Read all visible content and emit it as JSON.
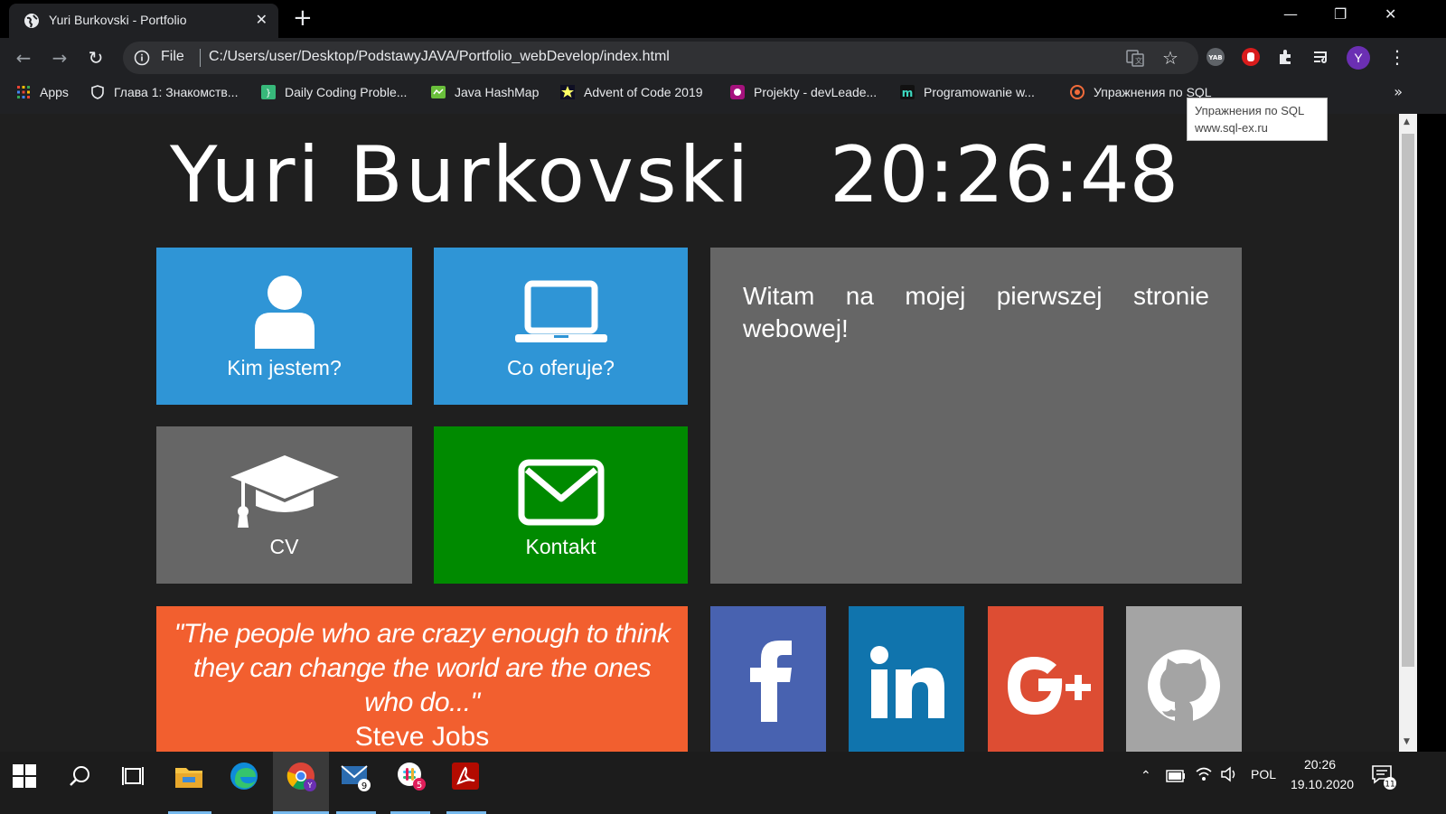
{
  "browser": {
    "tab_title": "Yuri Burkovski - Portfolio",
    "new_tab": "+",
    "address_scheme": "File",
    "address_url": "C:/Users/user/Desktop/PodstawyJAVA/Portfolio_webDevelop/index.html",
    "profile_letter": "Y",
    "ext_yab": "YAB"
  },
  "bookmarks": {
    "items": [
      {
        "label": "Apps"
      },
      {
        "label": "Глава 1: Знакомств..."
      },
      {
        "label": "Daily Coding Proble..."
      },
      {
        "label": "Java HashMap"
      },
      {
        "label": "Advent of Code 2019"
      },
      {
        "label": "Projekty - devLeade..."
      },
      {
        "label": "Programowanie w..."
      },
      {
        "label": "Упражнения по SQL"
      }
    ],
    "more": "»",
    "tooltip_title": "Упражнения по SQL",
    "tooltip_url": "www.sql-ex.ru"
  },
  "page": {
    "name": "Yuri Burkovski",
    "clock": "20:26:48",
    "tiles": {
      "about": "Kim jestem?",
      "offer": "Co oferuje?",
      "cv": "CV",
      "contact": "Kontakt"
    },
    "welcome": "Witam na mojej pierwszej stronie webowej!",
    "quote_text": "\"The people who are crazy enough to think they can change the world are the ones who do...\"",
    "quote_author": "Steve Jobs",
    "colors": {
      "blue_tile": "#2f95d6",
      "gray_tile": "#666666",
      "green_tile": "#008a00",
      "quote_bg": "#f25f2f",
      "facebook": "#4862b0",
      "linkedin": "#1074ad",
      "googleplus": "#dd4d33",
      "github": "#a4a4a4"
    }
  },
  "taskbar": {
    "mail_badge": "9",
    "slack_badge": "5",
    "lang": "POL",
    "time": "20:26",
    "date": "19.10.2020",
    "notif_count": "11"
  }
}
